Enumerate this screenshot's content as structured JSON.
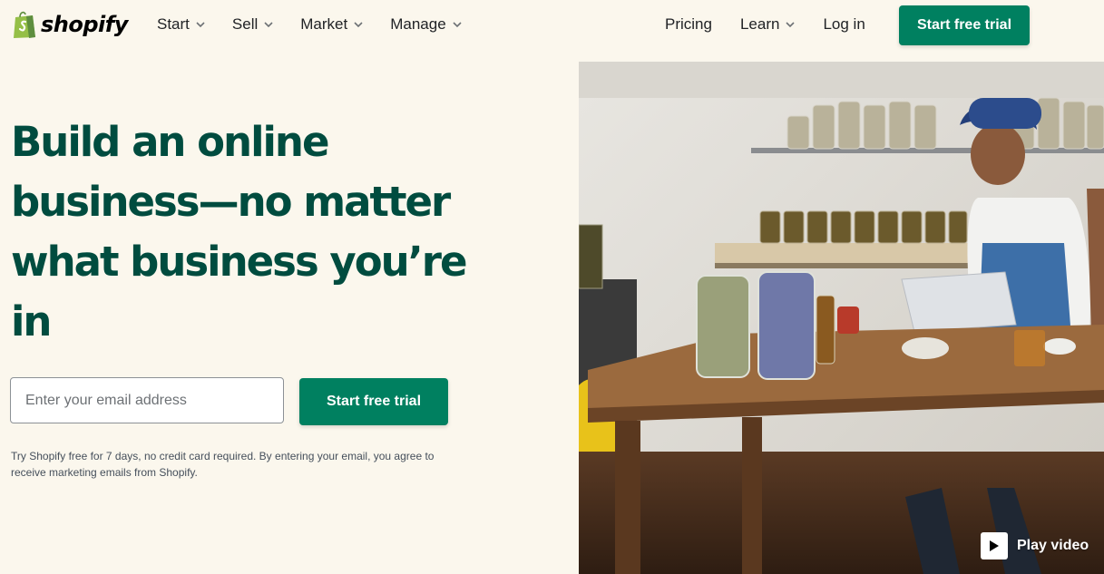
{
  "brand": {
    "name": "shopify",
    "color": "#008060",
    "heading_color": "#004c3f",
    "background": "#fbf7ed"
  },
  "nav": {
    "items": [
      {
        "label": "Start"
      },
      {
        "label": "Sell"
      },
      {
        "label": "Market"
      },
      {
        "label": "Manage"
      }
    ],
    "pricing": "Pricing",
    "learn": "Learn",
    "login": "Log in",
    "cta": "Start free trial"
  },
  "hero": {
    "title": "Build an online business—no matter what business you’re in",
    "email_placeholder": "Enter your email address",
    "email_value": "",
    "cta": "Start free trial",
    "disclaimer": "Try Shopify free for 7 days, no credit card required. By entering your email, you agree to receive marketing emails from Shopify."
  },
  "video": {
    "label": "Play video",
    "icon": "play-icon"
  }
}
